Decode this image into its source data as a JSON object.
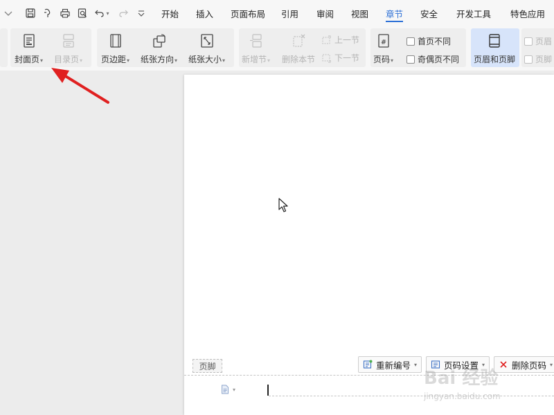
{
  "tabs": [
    {
      "label": "开始"
    },
    {
      "label": "插入"
    },
    {
      "label": "页面布局"
    },
    {
      "label": "引用"
    },
    {
      "label": "审阅"
    },
    {
      "label": "视图"
    },
    {
      "label": "章节",
      "active": true
    },
    {
      "label": "安全"
    },
    {
      "label": "开发工具"
    },
    {
      "label": "特色应用"
    }
  ],
  "ribbon": {
    "cover_page": "封面页",
    "toc_page": "目录页",
    "margins": "页边距",
    "orientation": "纸张方向",
    "paper_size": "纸张大小",
    "new_section": "新增节",
    "delete_section": "删除本节",
    "prev_section": "上一节",
    "next_section": "下一节",
    "page_number": "页码",
    "first_page_diff": "首页不同",
    "odd_even_diff": "奇偶页不同",
    "header_footer": "页眉和页脚",
    "header_cut": "页眉",
    "footer_cut": "页脚"
  },
  "footer_area": {
    "footer_tag": "页脚",
    "renumber": "重新编号",
    "page_number_settings": "页码设置",
    "delete_page_number": "删除页码"
  },
  "watermark": {
    "main": "Bai 经验",
    "sub": "jingyan.baidu.com"
  },
  "colors": {
    "accent": "#2b6fd6",
    "arrow": "#e02020",
    "highlight_group": "#d7e4fa"
  }
}
